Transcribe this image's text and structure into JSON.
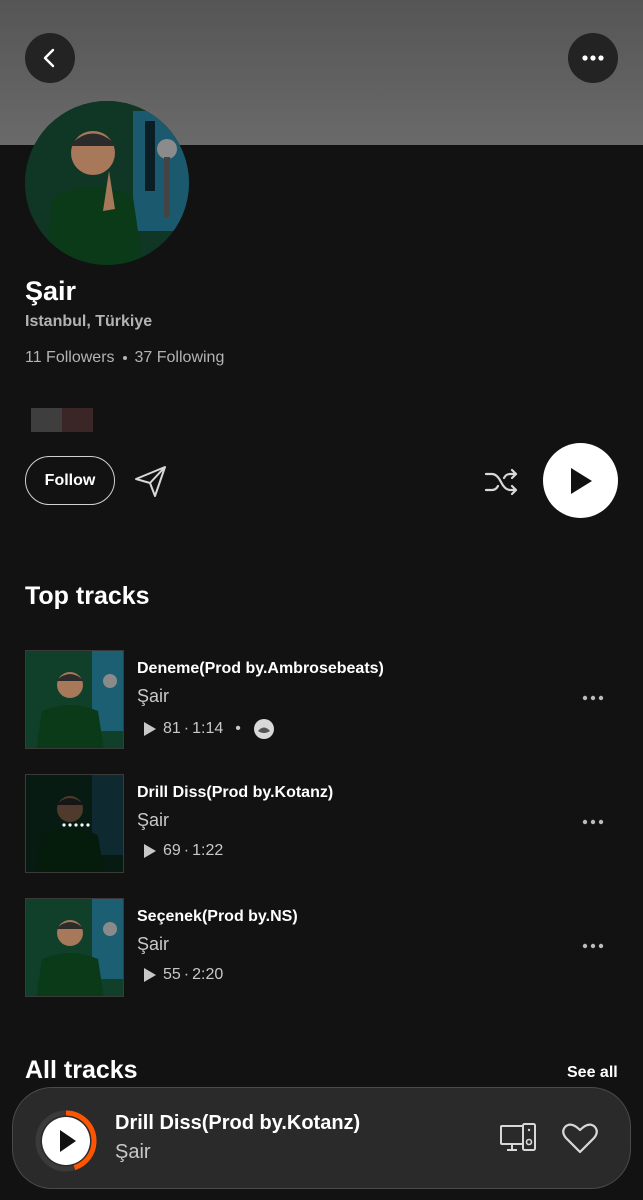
{
  "profile": {
    "name": "Şair",
    "location": "Istanbul, Türkiye",
    "followers": "11 Followers",
    "following": "37 Following"
  },
  "actions": {
    "follow_label": "Follow"
  },
  "top_tracks": {
    "title": "Top tracks",
    "items": [
      {
        "title": "Deneme(Prod by.Ambrosebeats)",
        "artist": "Şair",
        "plays": "81",
        "duration": "1:14"
      },
      {
        "title": "Drill Diss(Prod by.Kotanz)",
        "artist": "Şair",
        "plays": "69",
        "duration": "1:22"
      },
      {
        "title": "Seçenek(Prod by.NS)",
        "artist": "Şair",
        "plays": "55",
        "duration": "2:20"
      }
    ]
  },
  "all_tracks": {
    "title": "All tracks",
    "see_all_label": "See all"
  },
  "mini_player": {
    "title": "Drill Diss(Prod by.Kotanz)",
    "artist": "Şair",
    "progress": 0.45,
    "progress_color": "#ff5500"
  },
  "colors": {
    "background": "#121212",
    "header_band": "#5f5f5f",
    "accent": "#ff5500"
  }
}
